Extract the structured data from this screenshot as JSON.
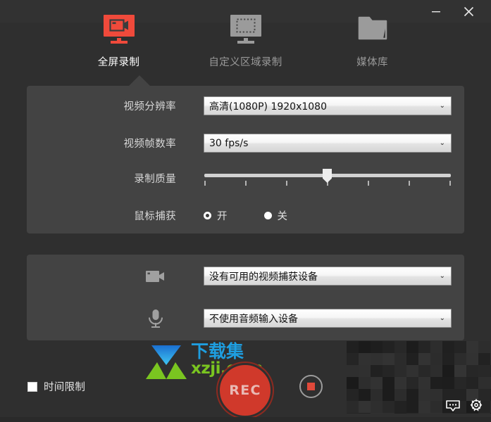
{
  "window": {
    "minimize_label": "—",
    "close_label": "✕",
    "minimize_icon": "minimize-icon",
    "close_icon": "close-icon"
  },
  "tabs": [
    {
      "label": "全屏录制",
      "icon": "monitor-record-icon",
      "active": true
    },
    {
      "label": "自定义区域录制",
      "icon": "monitor-region-select-icon",
      "active": false
    },
    {
      "label": "媒体库",
      "icon": "folder-icon",
      "active": false
    }
  ],
  "settings": {
    "resolution": {
      "label": "视频分辨率",
      "value": "高清(1080P)   1920x1080",
      "caret": "⌄"
    },
    "framerate": {
      "label": "视频帧数率",
      "value": "30 fps/s",
      "caret": "⌄"
    },
    "quality": {
      "label": "录制质量",
      "ticks": 7,
      "value": 3,
      "min": 0,
      "max": 6
    },
    "mouse_capture": {
      "label": "鼠标捕获",
      "options": [
        {
          "label": "开",
          "checked": true
        },
        {
          "label": "关",
          "checked": false
        }
      ]
    }
  },
  "devices": {
    "video": {
      "icon": "video-camera-icon",
      "value": "没有可用的视频捕获设备",
      "caret": "⌄"
    },
    "audio": {
      "icon": "microphone-icon",
      "value": "不使用音频输入设备",
      "caret": "⌄"
    }
  },
  "footer": {
    "time_limit": {
      "label": "时间限制",
      "checked": false
    },
    "record_button": {
      "label": "REC"
    },
    "stop_button": {
      "icon": "stop-square-icon"
    },
    "corner_icons": [
      {
        "icon": "screenshot-icon"
      },
      {
        "icon": "settings-gear-icon"
      }
    ]
  },
  "watermark": {
    "title": "下载集",
    "url": "xzji.com",
    "arrow_icon": "download-arrow-icon"
  },
  "colors": {
    "background": "#2f2f2f",
    "panel": "#434343",
    "titlebar": "#323232",
    "accent_red": "#f04a3b",
    "rec_red": "#d0392b",
    "tab_inactive": "#9a9a9a",
    "tab_active": "#ffffff",
    "watermark_blue": "#1e9ee0",
    "watermark_green": "#7ac520"
  }
}
